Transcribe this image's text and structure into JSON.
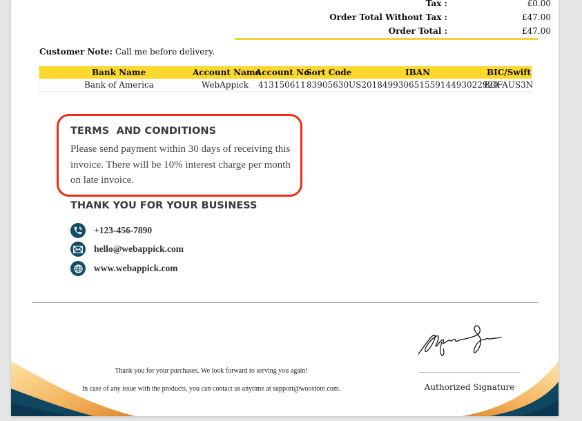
{
  "totals": [
    {
      "label": "Tax :",
      "value": "£0.00"
    },
    {
      "label": "Order Total Without Tax :",
      "value": "£47.00"
    },
    {
      "label": "Order Total :",
      "value": "£47.00"
    }
  ],
  "customer_note": {
    "label": "Customer Note:",
    "value": "Call me before delivery."
  },
  "bank_table": {
    "headers": [
      "Bank Name",
      "Account Name",
      "Account No",
      "Sort Code",
      "IBAN",
      "BIC/Swift"
    ],
    "row": [
      "Bank of America",
      "WebAppick",
      "413150611",
      "83905630",
      "US2018499306515591449302292​0",
      "BOFAUS3N"
    ]
  },
  "terms": {
    "title": "TERMS  AND CONDITIONS",
    "text": "Please send payment within 30 days of receiving this invoice. There will be 10% interest charge per month on late invoice."
  },
  "thanks_title": "THANK YOU FOR YOUR BUSINESS",
  "contacts": [
    {
      "icon": "phone-icon",
      "text": "+123-456-7890"
    },
    {
      "icon": "email-icon",
      "text": "hello@webappick.com"
    },
    {
      "icon": "globe-icon",
      "text": "www.webappick.com"
    }
  ],
  "footer": {
    "line1": "Thank you for your purchases. We look forward to serving you again!",
    "line2": "In case of any issue with the products, you can contact us anytime at support@woostore.com."
  },
  "signature": {
    "label": "Authorized Signature"
  },
  "colors": {
    "accent_yellow": "#fcd92c",
    "highlight_red": "#f02a13",
    "navy": "#144c64",
    "gold": "#e9a54a"
  }
}
